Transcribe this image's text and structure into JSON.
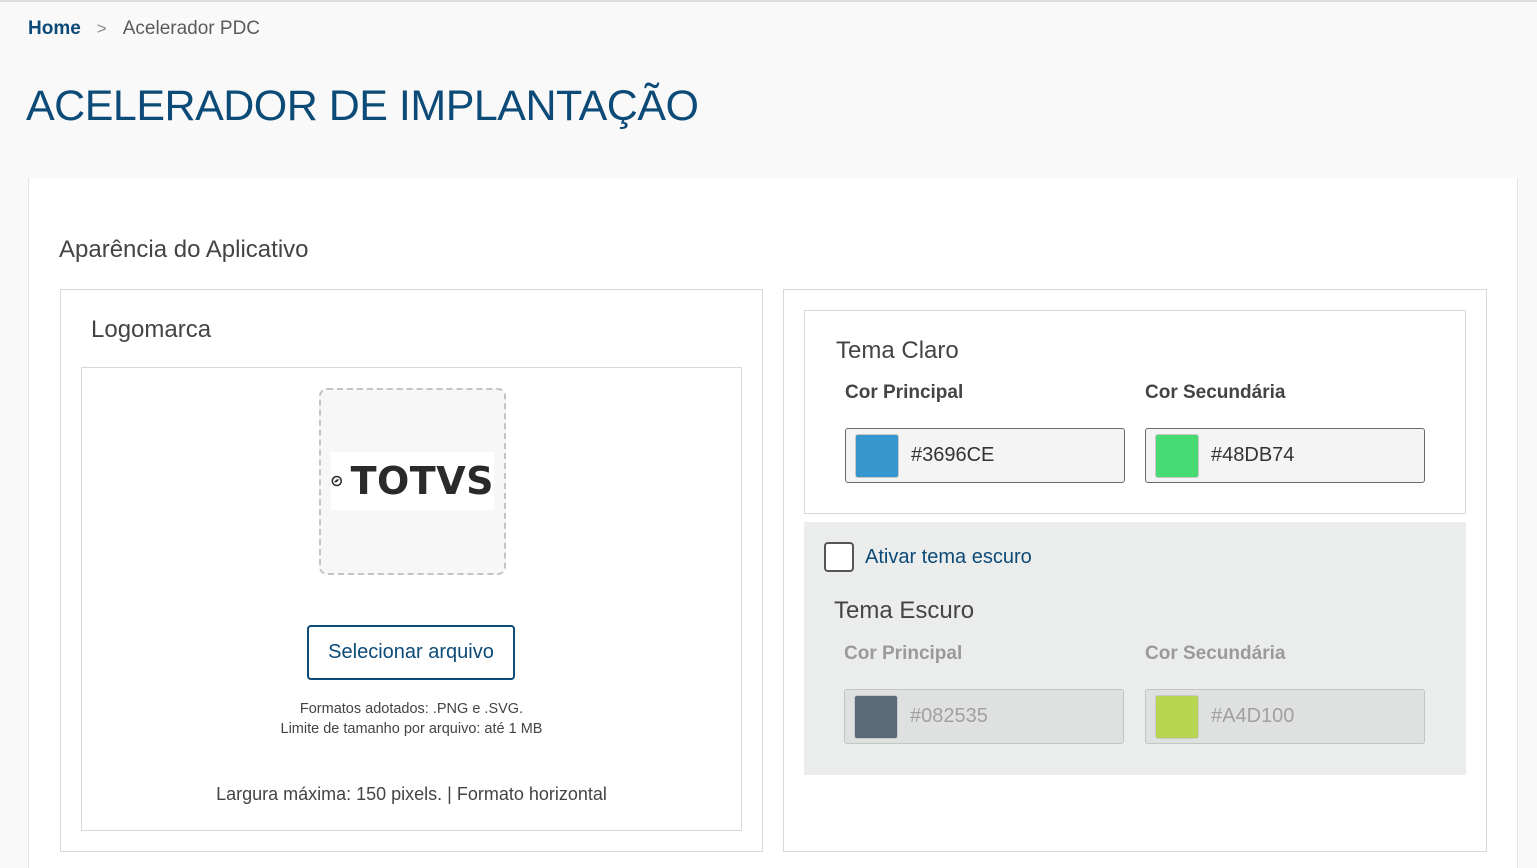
{
  "breadcrumb": {
    "home": "Home",
    "separator": ">",
    "current": "Acelerador PDC"
  },
  "page": {
    "title": "ACELERADOR DE IMPLANTAÇÃO"
  },
  "appearance": {
    "section_title": "Aparência do Aplicativo",
    "logo": {
      "heading": "Logomarca",
      "logo_text": "TOTVS",
      "select_button": "Selecionar arquivo",
      "formats_hint": "Formatos adotados: .PNG e .SVG.",
      "size_hint": "Limite de tamanho por arquivo: até 1 MB",
      "width_note": "Largura máxima: 150 pixels. | Formato horizontal"
    },
    "light_theme": {
      "heading": "Tema Claro",
      "primary_label": "Cor Principal",
      "primary_value": "#3696CE",
      "primary_color": "#3696CE",
      "secondary_label": "Cor Secundária",
      "secondary_value": "#48DB74",
      "secondary_color": "#48DB74"
    },
    "dark_theme": {
      "toggle_label": "Ativar tema escuro",
      "toggle_checked": false,
      "heading": "Tema Escuro",
      "primary_label": "Cor Principal",
      "primary_value": "#082535",
      "primary_color": "#5a6a76",
      "secondary_label": "Cor Secundária",
      "secondary_value": "#A4D100",
      "secondary_color": "#b8d652"
    }
  },
  "colors": {
    "brand": "#0c4a78"
  }
}
